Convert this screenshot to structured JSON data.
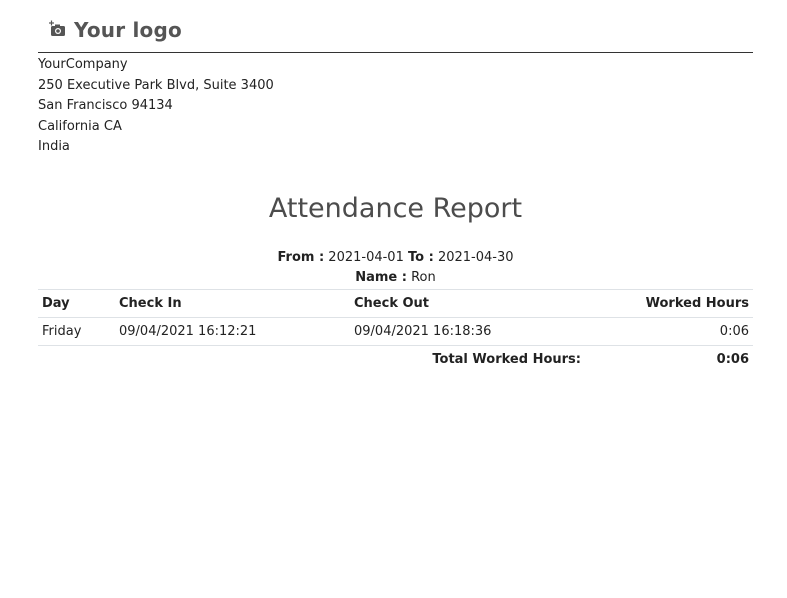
{
  "header": {
    "logo_text": "Your logo",
    "logo_icon": "camera-plus-icon"
  },
  "company": {
    "name": "YourCompany",
    "street": "250 Executive Park Blvd, Suite 3400",
    "city_zip": "San Francisco 94134",
    "state": "California CA",
    "country": "India"
  },
  "report": {
    "title": "Attendance Report",
    "from_label": "From :",
    "from_value": "2021-04-01",
    "to_label": "To :",
    "to_value": "2021-04-30",
    "name_label": "Name :",
    "name_value": "Ron"
  },
  "table": {
    "headers": [
      "Day",
      "Check In",
      "Check Out",
      "Worked Hours"
    ],
    "rows": [
      [
        "Friday",
        "09/04/2021 16:12:21",
        "09/04/2021 16:18:36",
        "0:06"
      ]
    ],
    "total_label": "Total Worked Hours:",
    "total_value": "0:06"
  }
}
